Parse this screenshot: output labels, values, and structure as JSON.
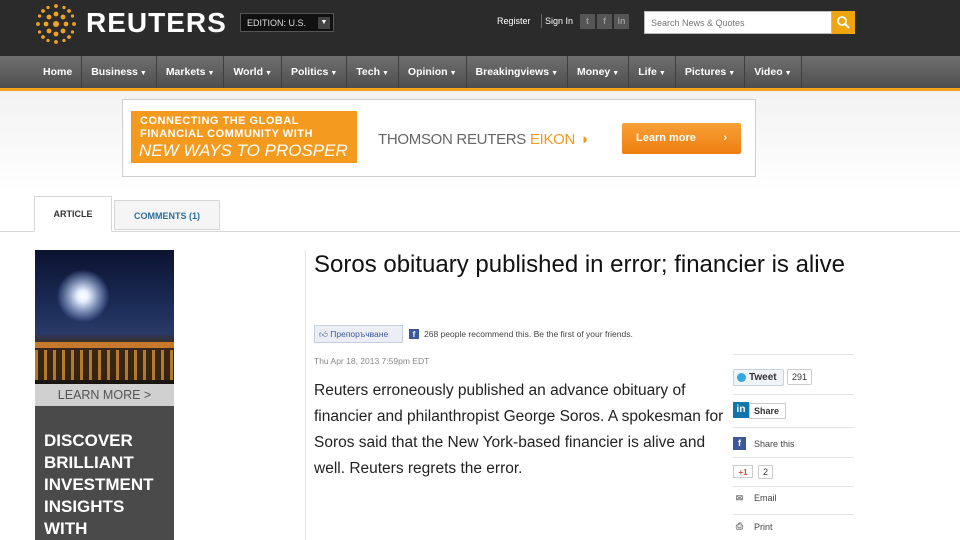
{
  "header": {
    "logo_text": "REUTERS",
    "edition": "EDITION: U.S.",
    "register": "Register",
    "sign_in": "Sign In",
    "search_placeholder": "Search News & Quotes",
    "accent_color": "#f2a31a"
  },
  "nav": {
    "items": [
      "Home",
      "Business",
      "Markets",
      "World",
      "Politics",
      "Tech",
      "Opinion",
      "Breakingviews",
      "Money",
      "Life",
      "Pictures",
      "Video"
    ],
    "dropdown_icon": "caret-down-icon"
  },
  "ad": {
    "line1": "CONNECTING THE GLOBAL",
    "line2": "FINANCIAL COMMUNITY WITH",
    "line3": "NEW WAYS TO PROSPER",
    "brand": "THOMSON REUTERS",
    "product": "EIKON",
    "cta": "Learn more"
  },
  "tabs": {
    "article": "ARTICLE",
    "comments": "COMMENTS (1)"
  },
  "promo": {
    "learn_more": "LEARN MORE >",
    "headline_lines": [
      "DISCOVER",
      "BRILLIANT",
      "INVESTMENT",
      "INSIGHTS",
      "WITH"
    ]
  },
  "article": {
    "headline": "Soros obituary published in error; financier is alive",
    "like_button": "Препоръчване",
    "recommend_text": "268 people recommend this. Be the first of your friends.",
    "dateline": "Thu Apr 18, 2013 7:59pm EDT",
    "body": "Reuters erroneously published an advance obituary of financier and philanthropist George Soros. A spokesman for Soros said that the New York-based financier is alive and well. Reuters regrets the error."
  },
  "share": {
    "tweet": "Tweet",
    "tweet_count": "291",
    "linkedin": "Share",
    "facebook": "Share this",
    "gplus": "+1",
    "gplus_count": "2",
    "email": "Email",
    "print": "Print"
  }
}
